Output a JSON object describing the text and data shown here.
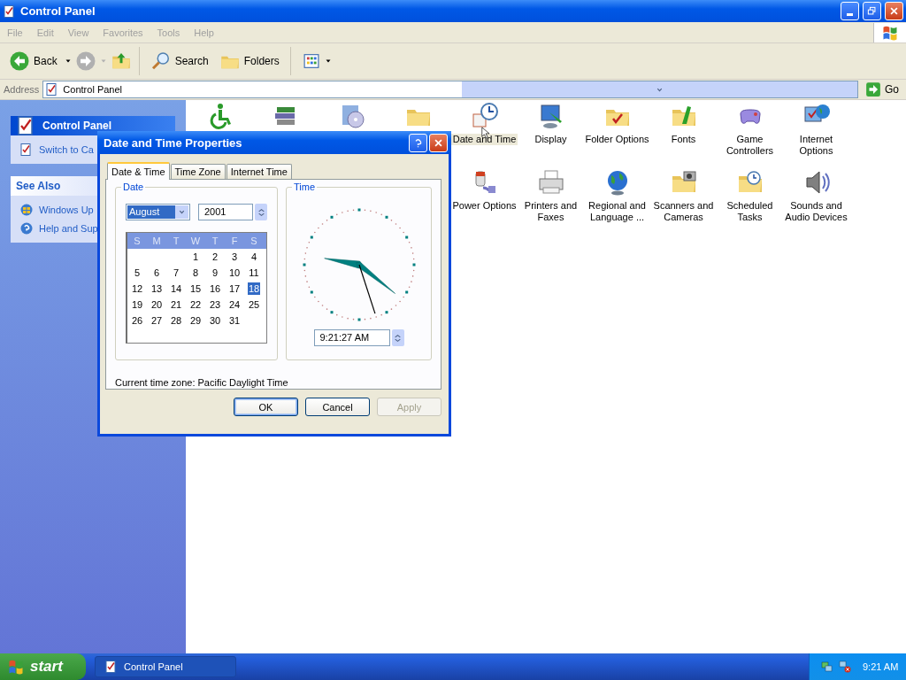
{
  "window": {
    "title": "Control Panel"
  },
  "menu": [
    "File",
    "Edit",
    "View",
    "Favorites",
    "Tools",
    "Help"
  ],
  "toolbar": {
    "back": "Back",
    "search": "Search",
    "folders": "Folders"
  },
  "address": {
    "label": "Address",
    "value": "Control Panel",
    "go": "Go"
  },
  "sidebar": {
    "panels": [
      {
        "title": "Control Panel",
        "items": [
          "Switch to Ca"
        ]
      },
      {
        "title": "See Also",
        "items": [
          "Windows Up",
          "Help and Sup"
        ]
      }
    ]
  },
  "applets": {
    "rows": [
      [
        {
          "kind": "icon"
        },
        {
          "kind": "icon"
        },
        {
          "kind": "icon"
        },
        {
          "kind": "icon"
        },
        {
          "kind": "applet",
          "label": "Date and Time",
          "selected": true
        },
        {
          "kind": "applet",
          "label": "Display",
          "selected": false
        },
        {
          "kind": "applet",
          "label": "Folder Options",
          "selected": false
        },
        {
          "kind": "applet",
          "label": "Fonts",
          "selected": false
        },
        {
          "kind": "applet",
          "label": "Game Controllers",
          "selected": false
        },
        {
          "kind": "applet",
          "label": "Internet Options",
          "selected": false
        }
      ],
      [
        "",
        "",
        "",
        "",
        {
          "kind": "applet",
          "label": "Power Options",
          "selected": false
        },
        {
          "kind": "applet",
          "label": "Printers and Faxes",
          "selected": false
        },
        {
          "kind": "applet",
          "label": "Regional and Language ...",
          "selected": false
        },
        {
          "kind": "applet",
          "label": "Scanners and Cameras",
          "selected": false
        },
        {
          "kind": "applet",
          "label": "Scheduled Tasks",
          "selected": false
        },
        {
          "kind": "applet",
          "label": "Sounds and Audio Devices",
          "selected": false
        }
      ]
    ]
  },
  "dialog": {
    "title": "Date and Time Properties",
    "tabs": [
      {
        "label": "Date & Time",
        "selected": true
      },
      {
        "label": "Time Zone",
        "selected": false
      },
      {
        "label": "Internet Time",
        "selected": false
      }
    ],
    "date_group": {
      "label": "Date",
      "month": "August",
      "year": "2001",
      "weekdays": [
        "S",
        "M",
        "T",
        "W",
        "T",
        "F",
        "S"
      ],
      "weeks": [
        [
          {
            "day": "1",
            "selected": false
          },
          {
            "day": "2",
            "selected": false
          },
          {
            "day": "3",
            "selected": false
          },
          {
            "day": "4",
            "selected": false
          }
        ],
        [
          {
            "day": "5",
            "selected": false
          },
          {
            "day": "6",
            "selected": false
          },
          {
            "day": "7",
            "selected": false
          },
          {
            "day": "8",
            "selected": false
          },
          {
            "day": "9",
            "selected": false
          },
          {
            "day": "10",
            "selected": false
          },
          {
            "day": "11",
            "selected": false
          }
        ],
        [
          {
            "day": "12",
            "selected": false
          },
          {
            "day": "13",
            "selected": false
          },
          {
            "day": "14",
            "selected": false
          },
          {
            "day": "15",
            "selected": false
          },
          {
            "day": "16",
            "selected": false
          },
          {
            "day": "17",
            "selected": false
          },
          {
            "day": "18",
            "selected": true
          }
        ],
        [
          {
            "day": "19",
            "selected": false
          },
          {
            "day": "20",
            "selected": false
          },
          {
            "day": "21",
            "selected": false
          },
          {
            "day": "22",
            "selected": false
          },
          {
            "day": "23",
            "selected": false
          },
          {
            "day": "24",
            "selected": false
          },
          {
            "day": "25",
            "selected": false
          }
        ],
        [
          {
            "day": "26",
            "selected": false
          },
          {
            "day": "27",
            "selected": false
          },
          {
            "day": "28",
            "selected": false
          },
          {
            "day": "29",
            "selected": false
          },
          {
            "day": "30",
            "selected": false
          },
          {
            "day": "31",
            "selected": false
          }
        ]
      ]
    },
    "time_group": {
      "label": "Time",
      "time": "9:21:27 AM"
    },
    "time_zone": "Current time zone:  Pacific Daylight Time",
    "buttons": [
      {
        "label": "OK",
        "default": true,
        "disabled": false
      },
      {
        "label": "Cancel",
        "default": false,
        "disabled": false
      },
      {
        "label": "Apply",
        "default": false,
        "disabled": true
      }
    ]
  },
  "taskbar": {
    "start": "start",
    "tasks": [
      {
        "label": "Control Panel"
      }
    ],
    "clock": "9:21 AM"
  }
}
